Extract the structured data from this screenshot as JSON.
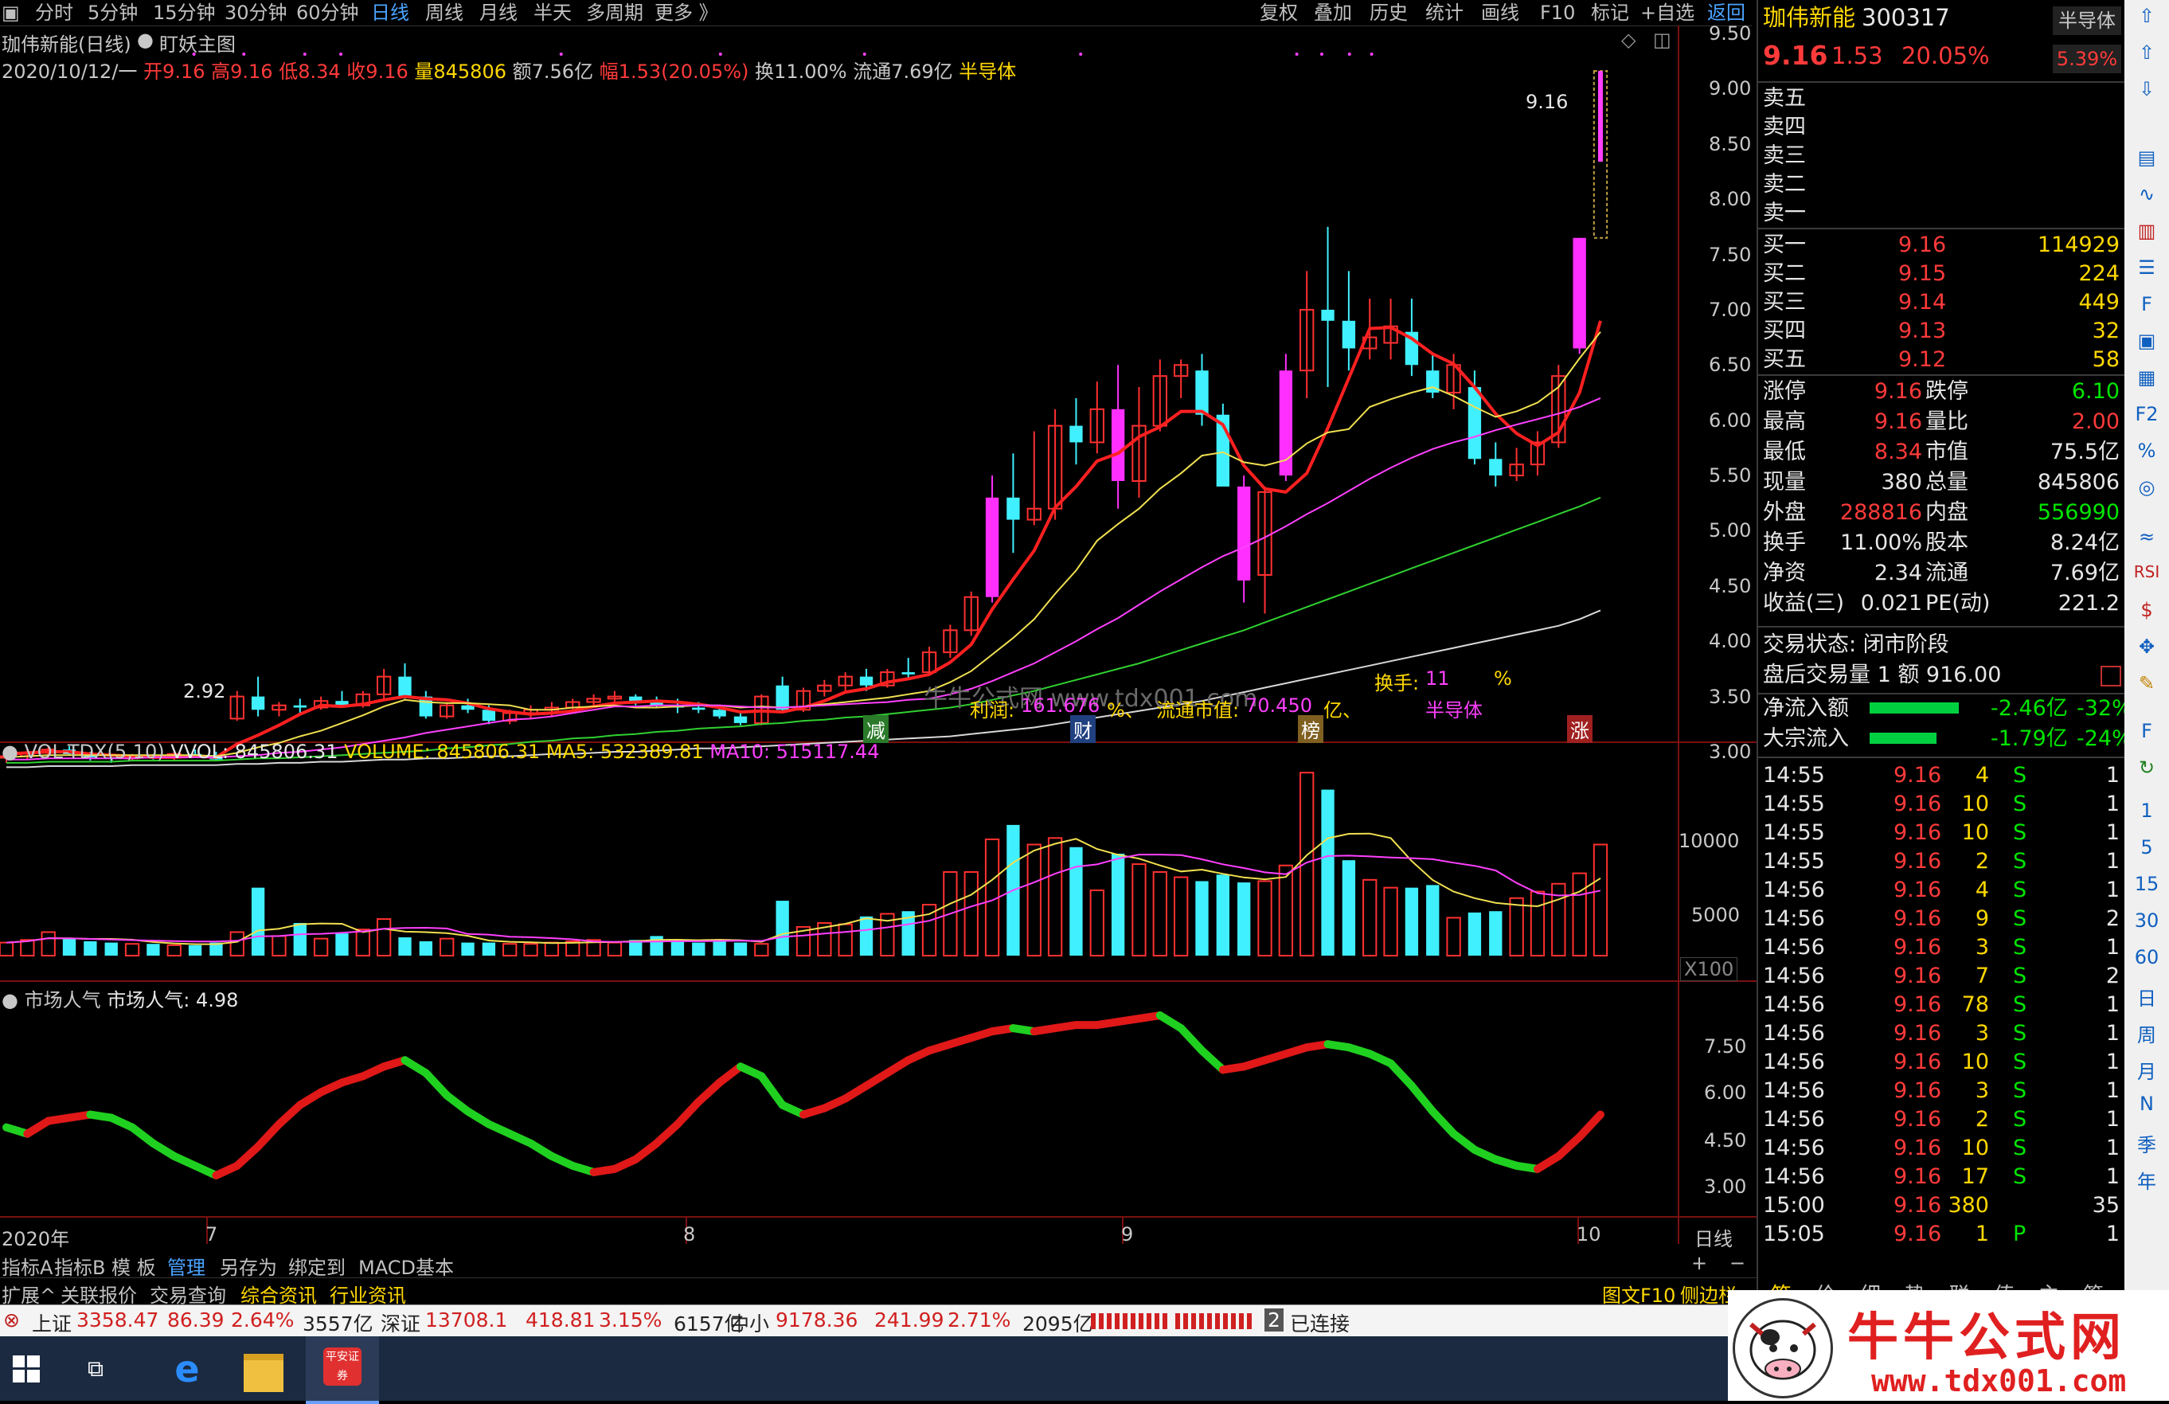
{
  "toolbar": {
    "left_tabs": [
      "分时",
      "5分钟",
      "15分钟",
      "30分钟",
      "60分钟",
      "日线",
      "周线",
      "月线",
      "半天",
      "多周期",
      "更多 》"
    ],
    "active_tab": "日线",
    "right_tabs": [
      "复权",
      "叠加",
      "历史",
      "统计",
      "画线",
      "F10",
      "标记",
      "+自选",
      "返回"
    ]
  },
  "chart": {
    "title": "珈伟新能(日线)",
    "strategy": "盯妖主图",
    "info_date": "2020/10/12/一",
    "info_open": "开9.16",
    "info_high": "高9.16",
    "info_low": "低8.34",
    "info_close": "收9.16",
    "info_vol": "量845806",
    "info_amount": "额7.56亿",
    "info_change": "幅1.53(20.05%)",
    "info_turnover": "换11.00%",
    "info_float": "流通7.69亿",
    "info_sector": "半导体",
    "price_axis": [
      "9.50",
      "9.00",
      "8.50",
      "8.00",
      "7.50",
      "7.00",
      "6.50",
      "6.00",
      "5.50",
      "5.00",
      "4.50",
      "4.00",
      "3.50",
      "3.00"
    ],
    "high_label": "9.16",
    "low_label": "2.92",
    "turnover_label": "换手:",
    "turnover_value": "11",
    "turnover_unit": "%",
    "watermark": "牛牛公式网 www.tdx001.com",
    "profit_label": "利润:",
    "profit_value": "161.676",
    "profit_unit": "%、",
    "mcap_label": "流通市值:",
    "mcap_value": "70.450",
    "mcap_unit": "亿、",
    "sector_tag": "半导体",
    "markers": [
      "减",
      "财",
      "榜",
      "涨"
    ],
    "candles": [
      [
        2.95,
        2.98,
        2.9,
        2.96
      ],
      [
        2.96,
        3.02,
        2.93,
        2.99
      ],
      [
        2.99,
        3.05,
        2.95,
        3.02
      ],
      [
        3.02,
        3.05,
        2.97,
        2.98
      ],
      [
        2.98,
        3.0,
        2.92,
        2.95
      ],
      [
        2.95,
        2.97,
        2.9,
        2.94
      ],
      [
        2.94,
        2.98,
        2.92,
        2.96
      ],
      [
        2.96,
        2.98,
        2.93,
        2.95
      ],
      [
        2.95,
        3.0,
        2.92,
        2.98
      ],
      [
        2.98,
        3.02,
        2.95,
        2.97
      ],
      [
        2.97,
        3.0,
        2.92,
        2.93
      ],
      [
        3.3,
        3.55,
        3.28,
        3.5
      ],
      [
        3.5,
        3.68,
        3.32,
        3.38
      ],
      [
        3.38,
        3.45,
        3.32,
        3.42
      ],
      [
        3.42,
        3.48,
        3.35,
        3.4
      ],
      [
        3.4,
        3.5,
        3.38,
        3.46
      ],
      [
        3.46,
        3.55,
        3.4,
        3.42
      ],
      [
        3.42,
        3.55,
        3.4,
        3.52
      ],
      [
        3.52,
        3.75,
        3.48,
        3.68
      ],
      [
        3.68,
        3.8,
        3.48,
        3.5
      ],
      [
        3.5,
        3.55,
        3.3,
        3.32
      ],
      [
        3.32,
        3.45,
        3.3,
        3.42
      ],
      [
        3.42,
        3.48,
        3.35,
        3.38
      ],
      [
        3.38,
        3.42,
        3.25,
        3.28
      ],
      [
        3.28,
        3.38,
        3.25,
        3.35
      ],
      [
        3.35,
        3.42,
        3.3,
        3.38
      ],
      [
        3.38,
        3.45,
        3.32,
        3.4
      ],
      [
        3.4,
        3.48,
        3.38,
        3.45
      ],
      [
        3.45,
        3.52,
        3.4,
        3.48
      ],
      [
        3.48,
        3.55,
        3.45,
        3.5
      ],
      [
        3.5,
        3.52,
        3.42,
        3.45
      ],
      [
        3.45,
        3.5,
        3.4,
        3.42
      ],
      [
        3.42,
        3.48,
        3.35,
        3.4
      ],
      [
        3.4,
        3.45,
        3.35,
        3.38
      ],
      [
        3.38,
        3.42,
        3.3,
        3.32
      ],
      [
        3.32,
        3.36,
        3.24,
        3.26
      ],
      [
        3.26,
        3.52,
        3.24,
        3.5
      ],
      [
        3.6,
        3.68,
        3.36,
        3.38
      ],
      [
        3.38,
        3.58,
        3.36,
        3.55
      ],
      [
        3.55,
        3.65,
        3.5,
        3.6
      ],
      [
        3.6,
        3.72,
        3.55,
        3.68
      ],
      [
        3.68,
        3.75,
        3.55,
        3.6
      ],
      [
        3.6,
        3.75,
        3.58,
        3.72
      ],
      [
        3.72,
        3.85,
        3.65,
        3.7
      ],
      [
        3.72,
        3.95,
        3.7,
        3.9
      ],
      [
        3.9,
        4.15,
        3.85,
        4.1
      ],
      [
        4.1,
        4.45,
        4.05,
        4.4
      ],
      [
        4.4,
        5.5,
        4.35,
        5.3
      ],
      [
        5.3,
        5.7,
        4.8,
        5.1
      ],
      [
        5.1,
        5.9,
        5.05,
        5.2
      ],
      [
        5.2,
        6.1,
        5.1,
        5.95
      ],
      [
        5.95,
        6.2,
        5.6,
        5.8
      ],
      [
        5.8,
        6.35,
        5.7,
        6.1
      ],
      [
        6.1,
        6.5,
        5.2,
        5.45
      ],
      [
        5.45,
        6.3,
        5.3,
        5.95
      ],
      [
        5.95,
        6.55,
        5.9,
        6.4
      ],
      [
        6.4,
        6.55,
        6.2,
        6.5
      ],
      [
        6.45,
        6.6,
        5.95,
        6.05
      ],
      [
        6.05,
        6.15,
        5.45,
        5.4
      ],
      [
        5.4,
        5.5,
        4.35,
        4.55
      ],
      [
        4.6,
        5.4,
        4.25,
        5.35
      ],
      [
        5.5,
        6.6,
        5.45,
        6.45
      ],
      [
        6.45,
        7.35,
        6.2,
        7.0
      ],
      [
        7.0,
        7.75,
        6.3,
        6.9
      ],
      [
        6.9,
        7.35,
        6.45,
        6.65
      ],
      [
        6.65,
        7.1,
        6.55,
        6.75
      ],
      [
        6.7,
        7.1,
        6.55,
        6.85
      ],
      [
        6.8,
        7.1,
        6.4,
        6.5
      ],
      [
        6.45,
        6.6,
        6.2,
        6.25
      ],
      [
        6.25,
        6.6,
        6.1,
        6.5
      ],
      [
        6.3,
        6.45,
        5.6,
        5.65
      ],
      [
        5.65,
        5.8,
        5.4,
        5.5
      ],
      [
        5.5,
        5.75,
        5.45,
        5.6
      ],
      [
        5.6,
        5.9,
        5.5,
        5.8
      ],
      [
        5.8,
        6.5,
        5.75,
        6.4
      ],
      [
        6.65,
        7.65,
        6.6,
        7.65
      ],
      [
        8.34,
        9.16,
        8.34,
        9.16
      ]
    ],
    "ma_sets": [
      {
        "name": "MA5",
        "color": "#ff2020",
        "values": [
          2.98,
          2.99,
          3.0,
          3.0,
          2.98,
          2.97,
          2.96,
          2.95,
          2.95,
          2.96,
          2.95,
          3.07,
          3.15,
          3.24,
          3.34,
          3.42,
          3.41,
          3.43,
          3.47,
          3.5,
          3.48,
          3.47,
          3.44,
          3.39,
          3.36,
          3.34,
          3.35,
          3.37,
          3.41,
          3.44,
          3.45,
          3.46,
          3.45,
          3.43,
          3.4,
          3.36,
          3.37,
          3.36,
          3.4,
          3.46,
          3.54,
          3.57,
          3.63,
          3.66,
          3.7,
          3.81,
          3.97,
          4.29,
          4.56,
          4.82,
          5.21,
          5.4,
          5.63,
          5.7,
          5.85,
          5.94,
          6.08,
          6.08,
          5.96,
          5.59,
          5.38,
          5.35,
          5.52,
          5.93,
          6.38,
          6.83,
          6.84,
          6.74,
          6.6,
          6.51,
          6.3,
          6.06,
          5.88,
          5.77,
          5.89,
          6.25,
          6.9
        ]
      },
      {
        "name": "MA10",
        "color": "#f0e050",
        "values": [
          2.95,
          2.96,
          2.97,
          2.97,
          2.97,
          2.97,
          2.97,
          2.97,
          2.97,
          2.97,
          2.96,
          2.99,
          3.04,
          3.08,
          3.14,
          3.19,
          3.26,
          3.33,
          3.41,
          3.47,
          3.45,
          3.44,
          3.44,
          3.43,
          3.42,
          3.38,
          3.38,
          3.4,
          3.41,
          3.42,
          3.4,
          3.4,
          3.41,
          3.42,
          3.42,
          3.4,
          3.41,
          3.4,
          3.41,
          3.43,
          3.45,
          3.47,
          3.49,
          3.52,
          3.55,
          3.63,
          3.73,
          3.88,
          4.03,
          4.2,
          4.43,
          4.64,
          4.91,
          5.06,
          5.2,
          5.38,
          5.52,
          5.68,
          5.71,
          5.62,
          5.59,
          5.64,
          5.79,
          5.89,
          5.92,
          6.12,
          6.19,
          6.25,
          6.3,
          6.22,
          6.12,
          6.03,
          6.08,
          6.16,
          6.3,
          6.56,
          6.8
        ]
      },
      {
        "name": "MA20",
        "color": "#ff40ff",
        "values": [
          2.93,
          2.93,
          2.94,
          2.94,
          2.94,
          2.94,
          2.94,
          2.95,
          2.95,
          2.95,
          2.95,
          2.96,
          2.97,
          2.99,
          3.0,
          3.02,
          3.04,
          3.07,
          3.1,
          3.13,
          3.17,
          3.2,
          3.23,
          3.26,
          3.29,
          3.3,
          3.32,
          3.35,
          3.38,
          3.41,
          3.41,
          3.42,
          3.42,
          3.42,
          3.42,
          3.41,
          3.4,
          3.4,
          3.41,
          3.42,
          3.43,
          3.44,
          3.45,
          3.47,
          3.48,
          3.52,
          3.57,
          3.64,
          3.72,
          3.8,
          3.9,
          4.0,
          4.11,
          4.21,
          4.33,
          4.45,
          4.56,
          4.67,
          4.77,
          4.85,
          4.94,
          5.04,
          5.15,
          5.25,
          5.36,
          5.47,
          5.57,
          5.66,
          5.74,
          5.8,
          5.85,
          5.91,
          5.96,
          6.01,
          6.06,
          6.12,
          6.2
        ]
      },
      {
        "name": "MA60",
        "color": "#30d030",
        "values": [
          2.9,
          2.9,
          2.91,
          2.91,
          2.91,
          2.91,
          2.92,
          2.92,
          2.92,
          2.92,
          2.92,
          2.93,
          2.94,
          2.94,
          2.95,
          2.96,
          2.97,
          2.98,
          2.99,
          3.0,
          3.01,
          3.03,
          3.04,
          3.06,
          3.07,
          3.09,
          3.1,
          3.12,
          3.13,
          3.15,
          3.16,
          3.18,
          3.19,
          3.21,
          3.22,
          3.23,
          3.25,
          3.26,
          3.28,
          3.29,
          3.31,
          3.32,
          3.34,
          3.36,
          3.38,
          3.4,
          3.43,
          3.47,
          3.51,
          3.55,
          3.6,
          3.65,
          3.7,
          3.75,
          3.8,
          3.86,
          3.92,
          3.98,
          4.04,
          4.1,
          4.17,
          4.24,
          4.31,
          4.38,
          4.45,
          4.52,
          4.59,
          4.66,
          4.73,
          4.8,
          4.87,
          4.94,
          5.01,
          5.08,
          5.15,
          5.22,
          5.3
        ]
      },
      {
        "name": "MA120",
        "color": "#d8d8d8",
        "values": [
          2.86,
          2.86,
          2.87,
          2.87,
          2.87,
          2.87,
          2.88,
          2.88,
          2.88,
          2.88,
          2.88,
          2.89,
          2.89,
          2.9,
          2.9,
          2.91,
          2.91,
          2.92,
          2.93,
          2.93,
          2.94,
          2.94,
          2.95,
          2.96,
          2.96,
          2.97,
          2.98,
          2.98,
          2.99,
          3.0,
          3.0,
          3.01,
          3.02,
          3.03,
          3.03,
          3.04,
          3.05,
          3.06,
          3.07,
          3.08,
          3.09,
          3.1,
          3.11,
          3.12,
          3.13,
          3.14,
          3.16,
          3.18,
          3.2,
          3.22,
          3.25,
          3.28,
          3.31,
          3.34,
          3.37,
          3.4,
          3.43,
          3.46,
          3.5,
          3.54,
          3.58,
          3.62,
          3.66,
          3.7,
          3.74,
          3.78,
          3.82,
          3.86,
          3.9,
          3.94,
          3.98,
          4.02,
          4.06,
          4.1,
          4.14,
          4.2,
          4.28
        ]
      }
    ],
    "date_labels": [
      "2020年",
      "7",
      "8",
      "9",
      "10"
    ],
    "period": "日线"
  },
  "volume": {
    "title": "VOL-TDX(5,10)",
    "vvol": "VVOL: 845806.31",
    "volume": "VOLUME: 845806.31",
    "ma5": "MA5: 532389.81",
    "ma10": "MA10: 515117.44",
    "axis": [
      "10000",
      "5000"
    ],
    "unit": "X100",
    "bars": [
      1.0,
      1.2,
      1.8,
      1.3,
      1.1,
      1.0,
      0.9,
      0.9,
      0.8,
      0.8,
      1.0,
      1.8,
      5.2,
      1.5,
      2.5,
      1.3,
      1.7,
      2.0,
      2.8,
      1.4,
      1.1,
      1.3,
      1.0,
      1.0,
      0.9,
      0.9,
      1.0,
      1.1,
      1.2,
      1.0,
      1.2,
      1.5,
      1.2,
      1.0,
      1.2,
      1.0,
      0.9,
      4.2,
      2.2,
      2.5,
      2.4,
      3.0,
      3.2,
      3.4,
      3.9,
      6.4,
      6.4,
      8.9,
      10.0,
      8.5,
      9.0,
      8.3,
      5.0,
      7.8,
      7.0,
      6.4,
      6.0,
      5.7,
      6.2,
      5.6,
      5.7,
      6.9,
      14.0,
      12.7,
      7.3,
      5.8,
      5.2,
      5.2,
      5.4,
      2.9,
      3.3,
      3.4,
      4.4,
      4.9,
      5.5,
      6.3,
      8.5
    ]
  },
  "indicator": {
    "title": "市场人气",
    "label": "市场人气: 4.98",
    "axis": [
      "7.50",
      "6.00",
      "4.50",
      "3.00"
    ]
  },
  "panel": {
    "name": "珈伟新能",
    "code": "300317",
    "sector": "半导体",
    "price": "9.16",
    "change": "1.53",
    "pct": "20.05%",
    "sector_pct": "5.39%",
    "sells": [
      "卖五",
      "卖四",
      "卖三",
      "卖二",
      "卖一"
    ],
    "buys": [
      {
        "label": "买一",
        "price": "9.16",
        "vol": "114929"
      },
      {
        "label": "买二",
        "price": "9.15",
        "vol": "224"
      },
      {
        "label": "买三",
        "price": "9.14",
        "vol": "449"
      },
      {
        "label": "买四",
        "price": "9.13",
        "vol": "32"
      },
      {
        "label": "买五",
        "price": "9.12",
        "vol": "58"
      }
    ],
    "stats": [
      {
        "k1": "涨停",
        "v1": "9.16",
        "k2": "跌停",
        "v2": "6.10"
      },
      {
        "k1": "最高",
        "v1": "9.16",
        "k2": "量比",
        "v2": "2.00"
      },
      {
        "k1": "最低",
        "v1": "8.34",
        "k2": "市值",
        "v2": "75.5亿"
      },
      {
        "k1": "现量",
        "v1": "380",
        "k2": "总量",
        "v2": "845806"
      },
      {
        "k1": "外盘",
        "v1": "288816",
        "k2": "内盘",
        "v2": "556990"
      },
      {
        "k1": "换手",
        "v1": "11.00%",
        "k2": "股本",
        "v2": "8.24亿"
      },
      {
        "k1": "净资",
        "v1": "2.34",
        "k2": "流通",
        "v2": "7.69亿"
      },
      {
        "k1": "收益(三)",
        "v1": "0.021",
        "k2": "PE(动)",
        "v2": "221.2"
      }
    ],
    "trade_status": "交易状态: 闭市阶段",
    "after_hours": "盘后交易量 1 额 916.00",
    "net_inflow_label": "净流入额",
    "net_inflow_value": "-2.46亿",
    "net_inflow_pct": "-32%",
    "block_inflow_label": "大宗流入",
    "block_inflow_value": "-1.79亿",
    "block_inflow_pct": "-24%",
    "ticks": [
      {
        "t": "14:55",
        "p": "9.16",
        "v": "4",
        "s": "S",
        "n": "1"
      },
      {
        "t": "14:55",
        "p": "9.16",
        "v": "10",
        "s": "S",
        "n": "1"
      },
      {
        "t": "14:55",
        "p": "9.16",
        "v": "10",
        "s": "S",
        "n": "1"
      },
      {
        "t": "14:55",
        "p": "9.16",
        "v": "2",
        "s": "S",
        "n": "1"
      },
      {
        "t": "14:56",
        "p": "9.16",
        "v": "4",
        "s": "S",
        "n": "1"
      },
      {
        "t": "14:56",
        "p": "9.16",
        "v": "9",
        "s": "S",
        "n": "2"
      },
      {
        "t": "14:56",
        "p": "9.16",
        "v": "3",
        "s": "S",
        "n": "1"
      },
      {
        "t": "14:56",
        "p": "9.16",
        "v": "7",
        "s": "S",
        "n": "2"
      },
      {
        "t": "14:56",
        "p": "9.16",
        "v": "78",
        "s": "S",
        "n": "1"
      },
      {
        "t": "14:56",
        "p": "9.16",
        "v": "3",
        "s": "S",
        "n": "1"
      },
      {
        "t": "14:56",
        "p": "9.16",
        "v": "10",
        "s": "S",
        "n": "1"
      },
      {
        "t": "14:56",
        "p": "9.16",
        "v": "3",
        "s": "S",
        "n": "1"
      },
      {
        "t": "14:56",
        "p": "9.16",
        "v": "2",
        "s": "S",
        "n": "1"
      },
      {
        "t": "14:56",
        "p": "9.16",
        "v": "10",
        "s": "S",
        "n": "1"
      },
      {
        "t": "14:56",
        "p": "9.16",
        "v": "17",
        "s": "S",
        "n": "1"
      },
      {
        "t": "15:00",
        "p": "9.16",
        "v": "380",
        "s": "",
        "n": "35"
      },
      {
        "t": "15:05",
        "p": "9.16",
        "v": "1",
        "s": "P",
        "n": "1"
      }
    ],
    "bottom_tabs": [
      "笔",
      "价",
      "细",
      "势",
      "联",
      "值",
      "主",
      "筹"
    ]
  },
  "iconbar": [
    "1",
    "5",
    "15",
    "30",
    "60",
    "日",
    "周",
    "月",
    "N",
    "季",
    "年"
  ],
  "tabs1": [
    "指标A",
    "指标B",
    "模 板",
    "管理",
    "另存为",
    "绑定到",
    "MACD基本"
  ],
  "tabs1_right": [
    "+",
    "−"
  ],
  "tabs2": [
    "扩展^",
    "关联报价",
    "交易查询",
    "综合资讯",
    "行业资讯"
  ],
  "tabs2_right": [
    "图文F10",
    "侧边栏"
  ],
  "indexbar": {
    "sh_label": "上证",
    "sh_val": "3358.47",
    "sh_chg": "86.39",
    "sh_pct": "2.64%",
    "sh_amt": "3557亿",
    "sz_label": "深证",
    "sz_val": "13708.1",
    "sz_chg": "418.81",
    "sz_pct": "3.15%",
    "sz_amt": "6157亿",
    "zx_label": "中小",
    "zx_val": "9178.36",
    "zx_chg": "241.99",
    "zx_pct": "2.71%",
    "zx_amt": "2095亿",
    "conn_num": "2",
    "conn": "已连接"
  },
  "logo": {
    "title": "牛牛公式网",
    "url": "www.tdx001.com"
  },
  "taskbar_app": "平安证券"
}
